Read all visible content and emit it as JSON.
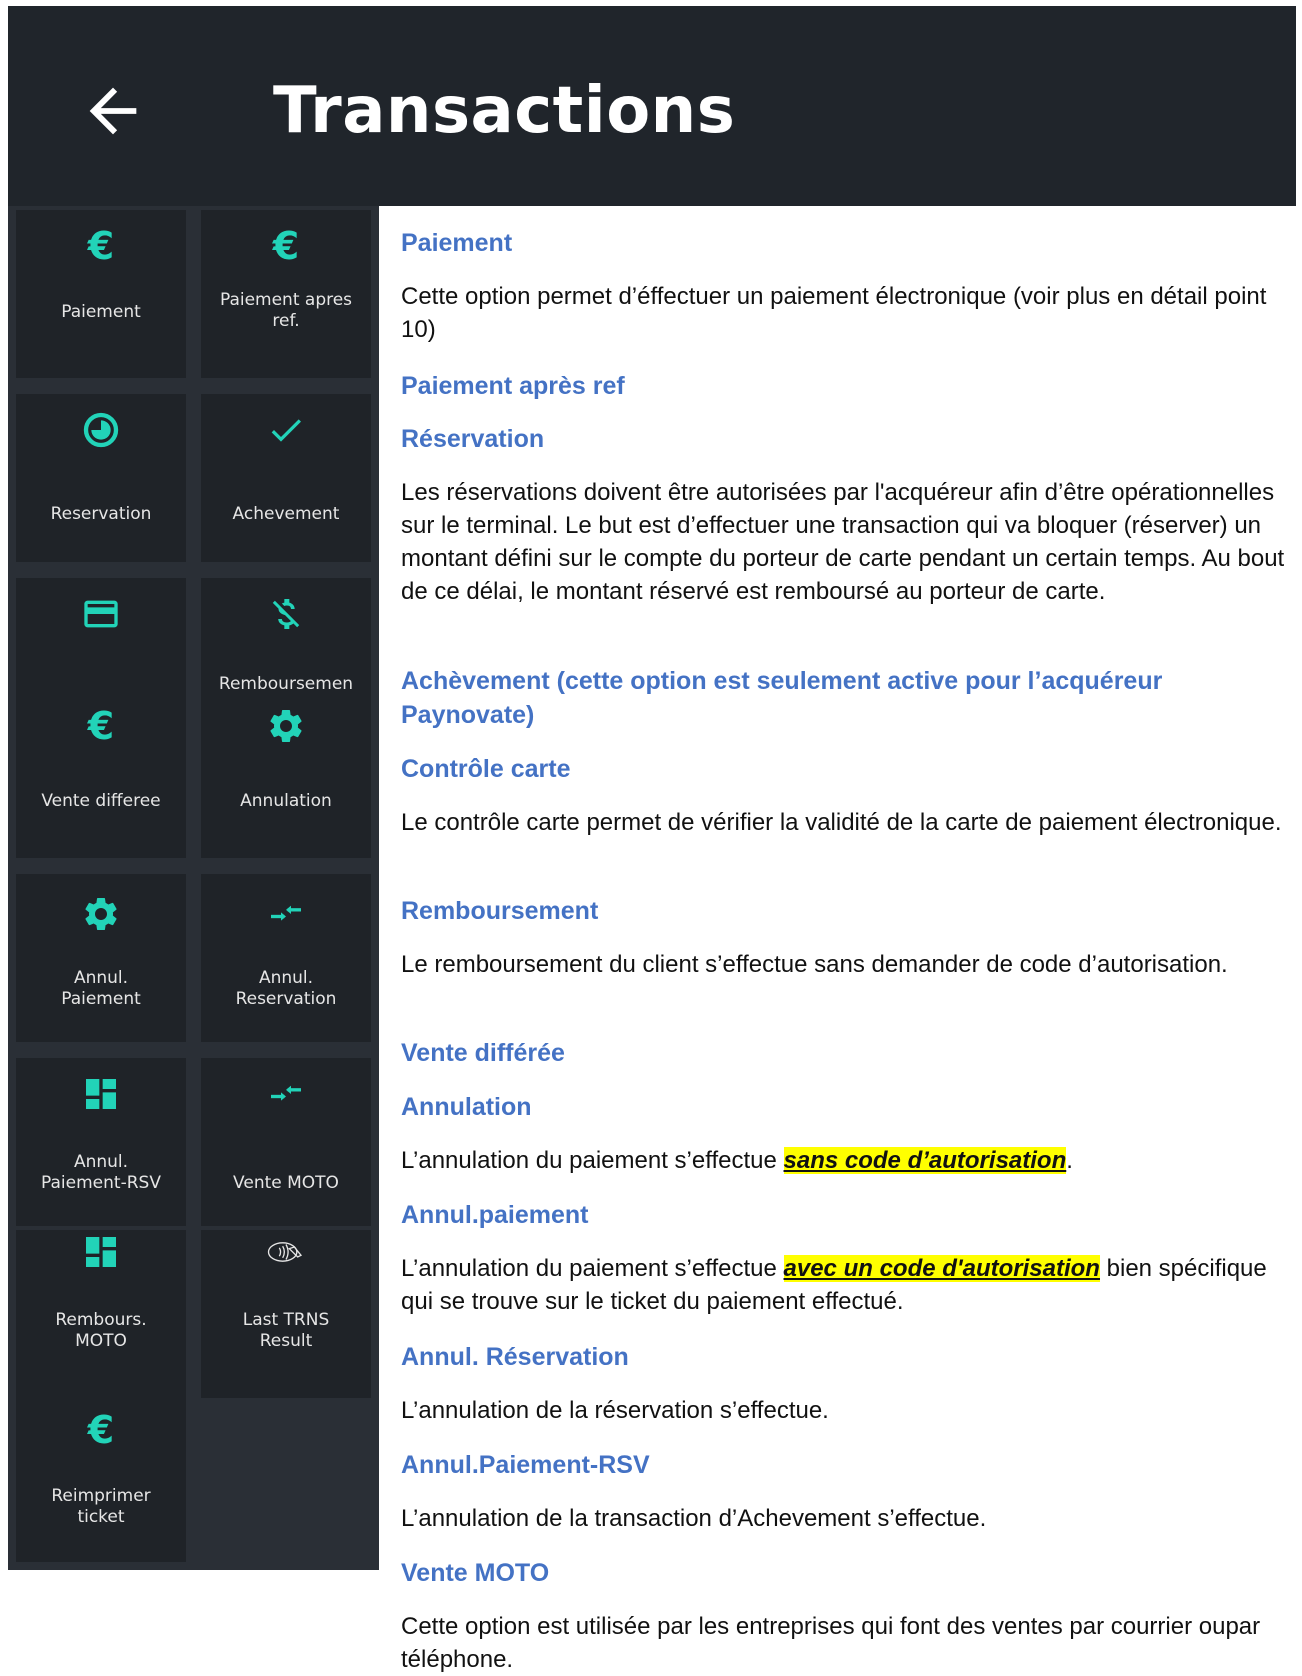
{
  "header": {
    "title": "Transactions"
  },
  "tiles": [
    {
      "label": "Paiement",
      "icon": "euro-icon"
    },
    {
      "label": "Paiement apres\nref.",
      "icon": "euro-icon"
    },
    {
      "label": "Reservation",
      "icon": "clock-icon"
    },
    {
      "label": "Achevement",
      "icon": "check-icon"
    },
    {
      "label": "",
      "icon": "credit-card-icon"
    },
    {
      "label": "Remboursemen",
      "icon": "money-off-icon"
    },
    {
      "label": "Vente differee",
      "icon": "euro-icon"
    },
    {
      "label": "Annulation",
      "icon": "gear-icon"
    },
    {
      "label": "Annul.\nPaiement",
      "icon": "gear-icon"
    },
    {
      "label": "Annul.\nReservation",
      "icon": "swap-arrows-icon"
    },
    {
      "label": "Annul.\nPaiement-RSV",
      "icon": "dashboard-icon"
    },
    {
      "label": "Vente MOTO",
      "icon": "swap-arrows-icon"
    },
    {
      "label": "Rembours.\nMOTO",
      "icon": "dashboard-icon"
    },
    {
      "label": "Last TRNS\nResult",
      "icon": "contactless-icon"
    },
    {
      "label": "Reimprimer\nticket",
      "icon": "euro-icon"
    }
  ],
  "colors": {
    "accent": "#22d3b8",
    "header_bg": "#20252b",
    "tile_bg": "#1f2328",
    "heading_blue": "#4472c4",
    "highlight": "#ffff00"
  },
  "doc": {
    "paiement_h": "Paiement",
    "paiement_p": "Cette option permet d’éffectuer un paiement électronique (voir plus en détail point 10)",
    "paiement_apres_ref_h": "Paiement après ref",
    "reservation_h": "Réservation",
    "reservation_p": "Les réservations doivent être autorisées par l'acquéreur afin d’être opérationnelles sur le terminal. Le but est d’effectuer une transaction qui va bloquer (réserver) un montant défini sur le compte du porteur de carte pendant un certain temps. Au bout de ce délai, le montant réservé est remboursé au porteur de carte.",
    "achevement_h": "Achèvement (cette option est seulement active pour l’acquéreur Paynovate)",
    "controle_carte_h": "Contrôle carte",
    "controle_carte_p": "Le contrôle carte permet de vérifier la validité de la carte de paiement électronique.",
    "remboursement_h": "Remboursement",
    "remboursement_p": "Le remboursement du client s’effectue sans demander de code d’autorisation.",
    "vente_differee_h": "Vente différée",
    "annulation_h": "Annulation",
    "annulation_p_pre": "L’annulation du paiement s’effectue ",
    "annulation_p_hl": "sans code d’autorisation",
    "annulation_p_post": ".",
    "annul_paiement_h": "Annul.paiement",
    "annul_paiement_p_pre": "L’annulation du paiement s’effectue ",
    "annul_paiement_p_hl": "avec un code d'autorisation",
    "annul_paiement_p_post": " bien spécifique qui se trouve sur le ticket du paiement effectué.",
    "annul_reservation_h": "Annul. Réservation",
    "annul_reservation_p": "L’annulation de la réservation s’effectue.",
    "annul_paiement_rsv_h": "Annul.Paiement-RSV",
    "annul_paiement_rsv_p": "L’annulation de la transaction d’Achevement s’effectue.",
    "vente_moto_h": "Vente MOTO",
    "vente_moto_p": "Cette option est utilisée par les entreprises qui font des ventes par courrier oupar téléphone."
  }
}
